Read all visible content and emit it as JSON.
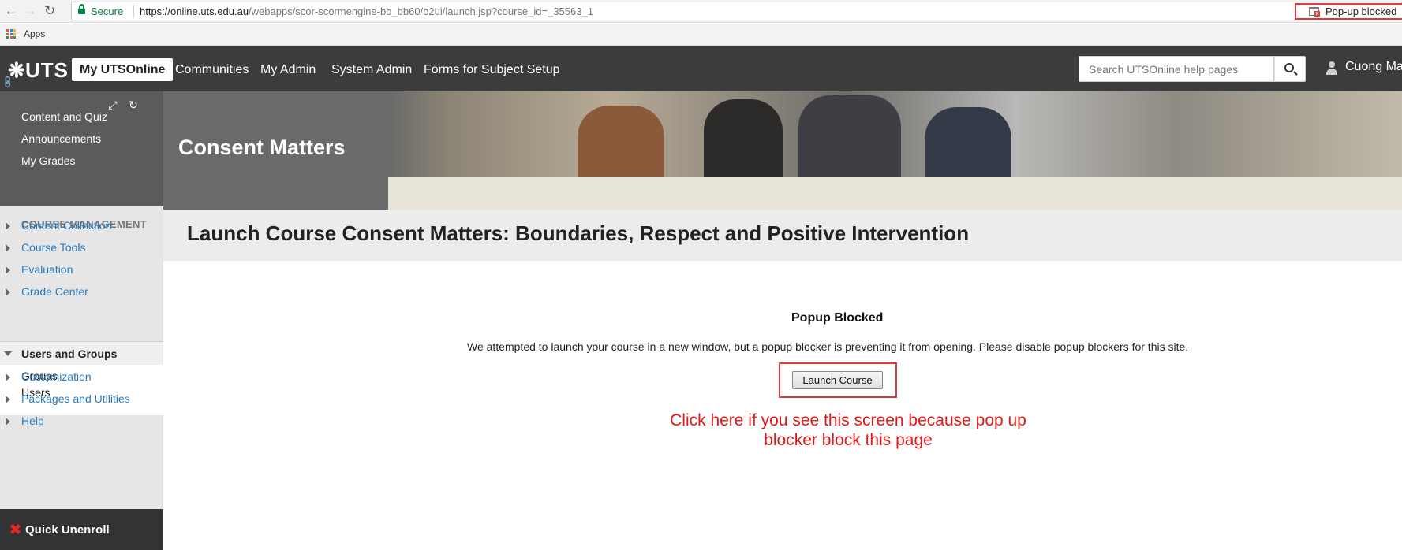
{
  "browser": {
    "secure_label": "Secure",
    "url_host": "https://online.uts.edu.au",
    "url_path": "/webapps/scor-scormengine-bb_bb60/b2ui/launch.jsp?course_id=_35563_1",
    "popup_blocked_label": "Pop-up blocked",
    "bookmarks": {
      "apps_label": "Apps"
    }
  },
  "topnav": {
    "logo_text": "UTS",
    "tabs": [
      {
        "label": "My UTSOnline",
        "active": true
      },
      {
        "label": "Communities",
        "active": false
      },
      {
        "label": "My Admin",
        "active": false
      },
      {
        "label": "System Admin",
        "active": false
      },
      {
        "label": "Forms for Subject Setup",
        "active": false
      }
    ],
    "search_placeholder": "Search UTSOnline help pages",
    "user_name": "Cuong Ma"
  },
  "sidebar": {
    "course_links": [
      "Content and Quiz",
      "Announcements",
      "My Grades"
    ],
    "course_management_header": "COURSE MANAGEMENT",
    "management_items": [
      "Content Collection",
      "Course Tools",
      "Evaluation",
      "Grade Center"
    ],
    "users_and_groups": {
      "label": "Users and Groups",
      "children": [
        "Groups",
        "Users"
      ]
    },
    "other_items": [
      "Customization",
      "Packages and Utilities",
      "Help"
    ],
    "quick_unenroll_label": "Quick Unenroll",
    "link_color": "#2a7bbf"
  },
  "banner": {
    "course_title": "Consent Matters"
  },
  "page": {
    "title": "Launch Course Consent Matters: Boundaries, Respect and Positive Intervention",
    "popup_title": "Popup Blocked",
    "popup_message": "We attempted to launch your course in a new window, but a popup blocker is preventing it from opening. Please disable popup blockers for this site.",
    "launch_button": "Launch Course",
    "annotation_line1": "Click here if you see this screen because pop up",
    "annotation_line2": "blocker block this page",
    "annotation_color": "#e01818"
  }
}
